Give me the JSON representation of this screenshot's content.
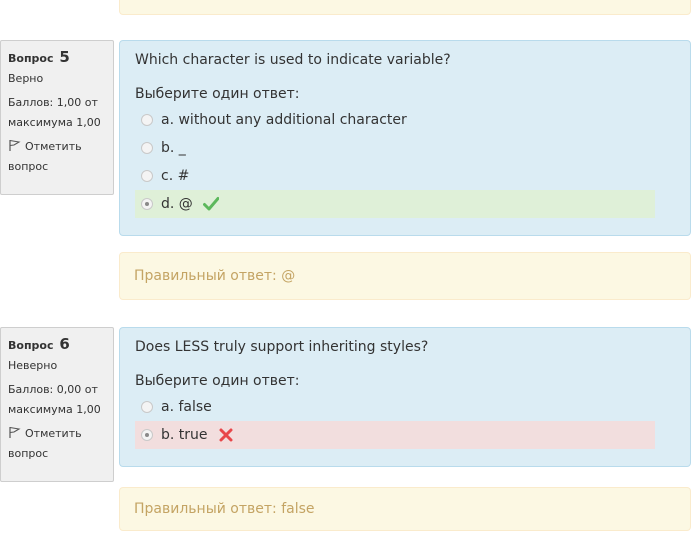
{
  "questions": [
    {
      "label": "Вопрос",
      "number": "5",
      "state": "Верно",
      "grade": "Баллов: 1,00 от максимума 1,00",
      "flag_label": "Отметить вопрос",
      "text": "Which character is used to indicate variable?",
      "prompt": "Выберите один ответ:",
      "options": [
        {
          "label": "a. without any additional character",
          "selected": false
        },
        {
          "label": "b. _",
          "selected": false
        },
        {
          "label": "c. #",
          "selected": false
        },
        {
          "label": "d. @",
          "selected": true,
          "result": "correct"
        }
      ],
      "right_answer": "Правильный ответ: @"
    },
    {
      "label": "Вопрос",
      "number": "6",
      "state": "Неверно",
      "grade": "Баллов: 0,00 от максимума 1,00",
      "flag_label": "Отметить вопрос",
      "text": "Does LESS truly support inheriting styles?",
      "prompt": "Выберите один ответ:",
      "options": [
        {
          "label": "a. false",
          "selected": false
        },
        {
          "label": "b. true",
          "selected": true,
          "result": "incorrect"
        }
      ],
      "right_answer": "Правильный ответ: false"
    }
  ],
  "colors": {
    "content_bg": "#dcedf5",
    "correct_bg": "#dff0d8",
    "incorrect_bg": "#f2dede",
    "rightanswer_bg": "#fcf8e3",
    "check_color": "#5cb85c",
    "cross_color": "#e8474a"
  },
  "icons": {
    "flag": "flag-icon",
    "correct": "check-icon",
    "incorrect": "cross-icon"
  }
}
